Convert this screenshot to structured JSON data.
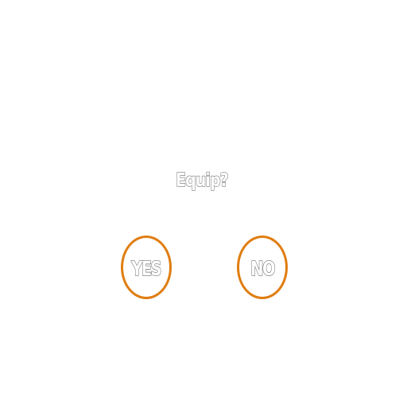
{
  "dialog": {
    "prompt": "Equip?",
    "yes_label": "YES",
    "no_label": "NO"
  },
  "colors": {
    "ring": "#e07d10",
    "text_outline": "#777777",
    "background": "#ffffff"
  }
}
